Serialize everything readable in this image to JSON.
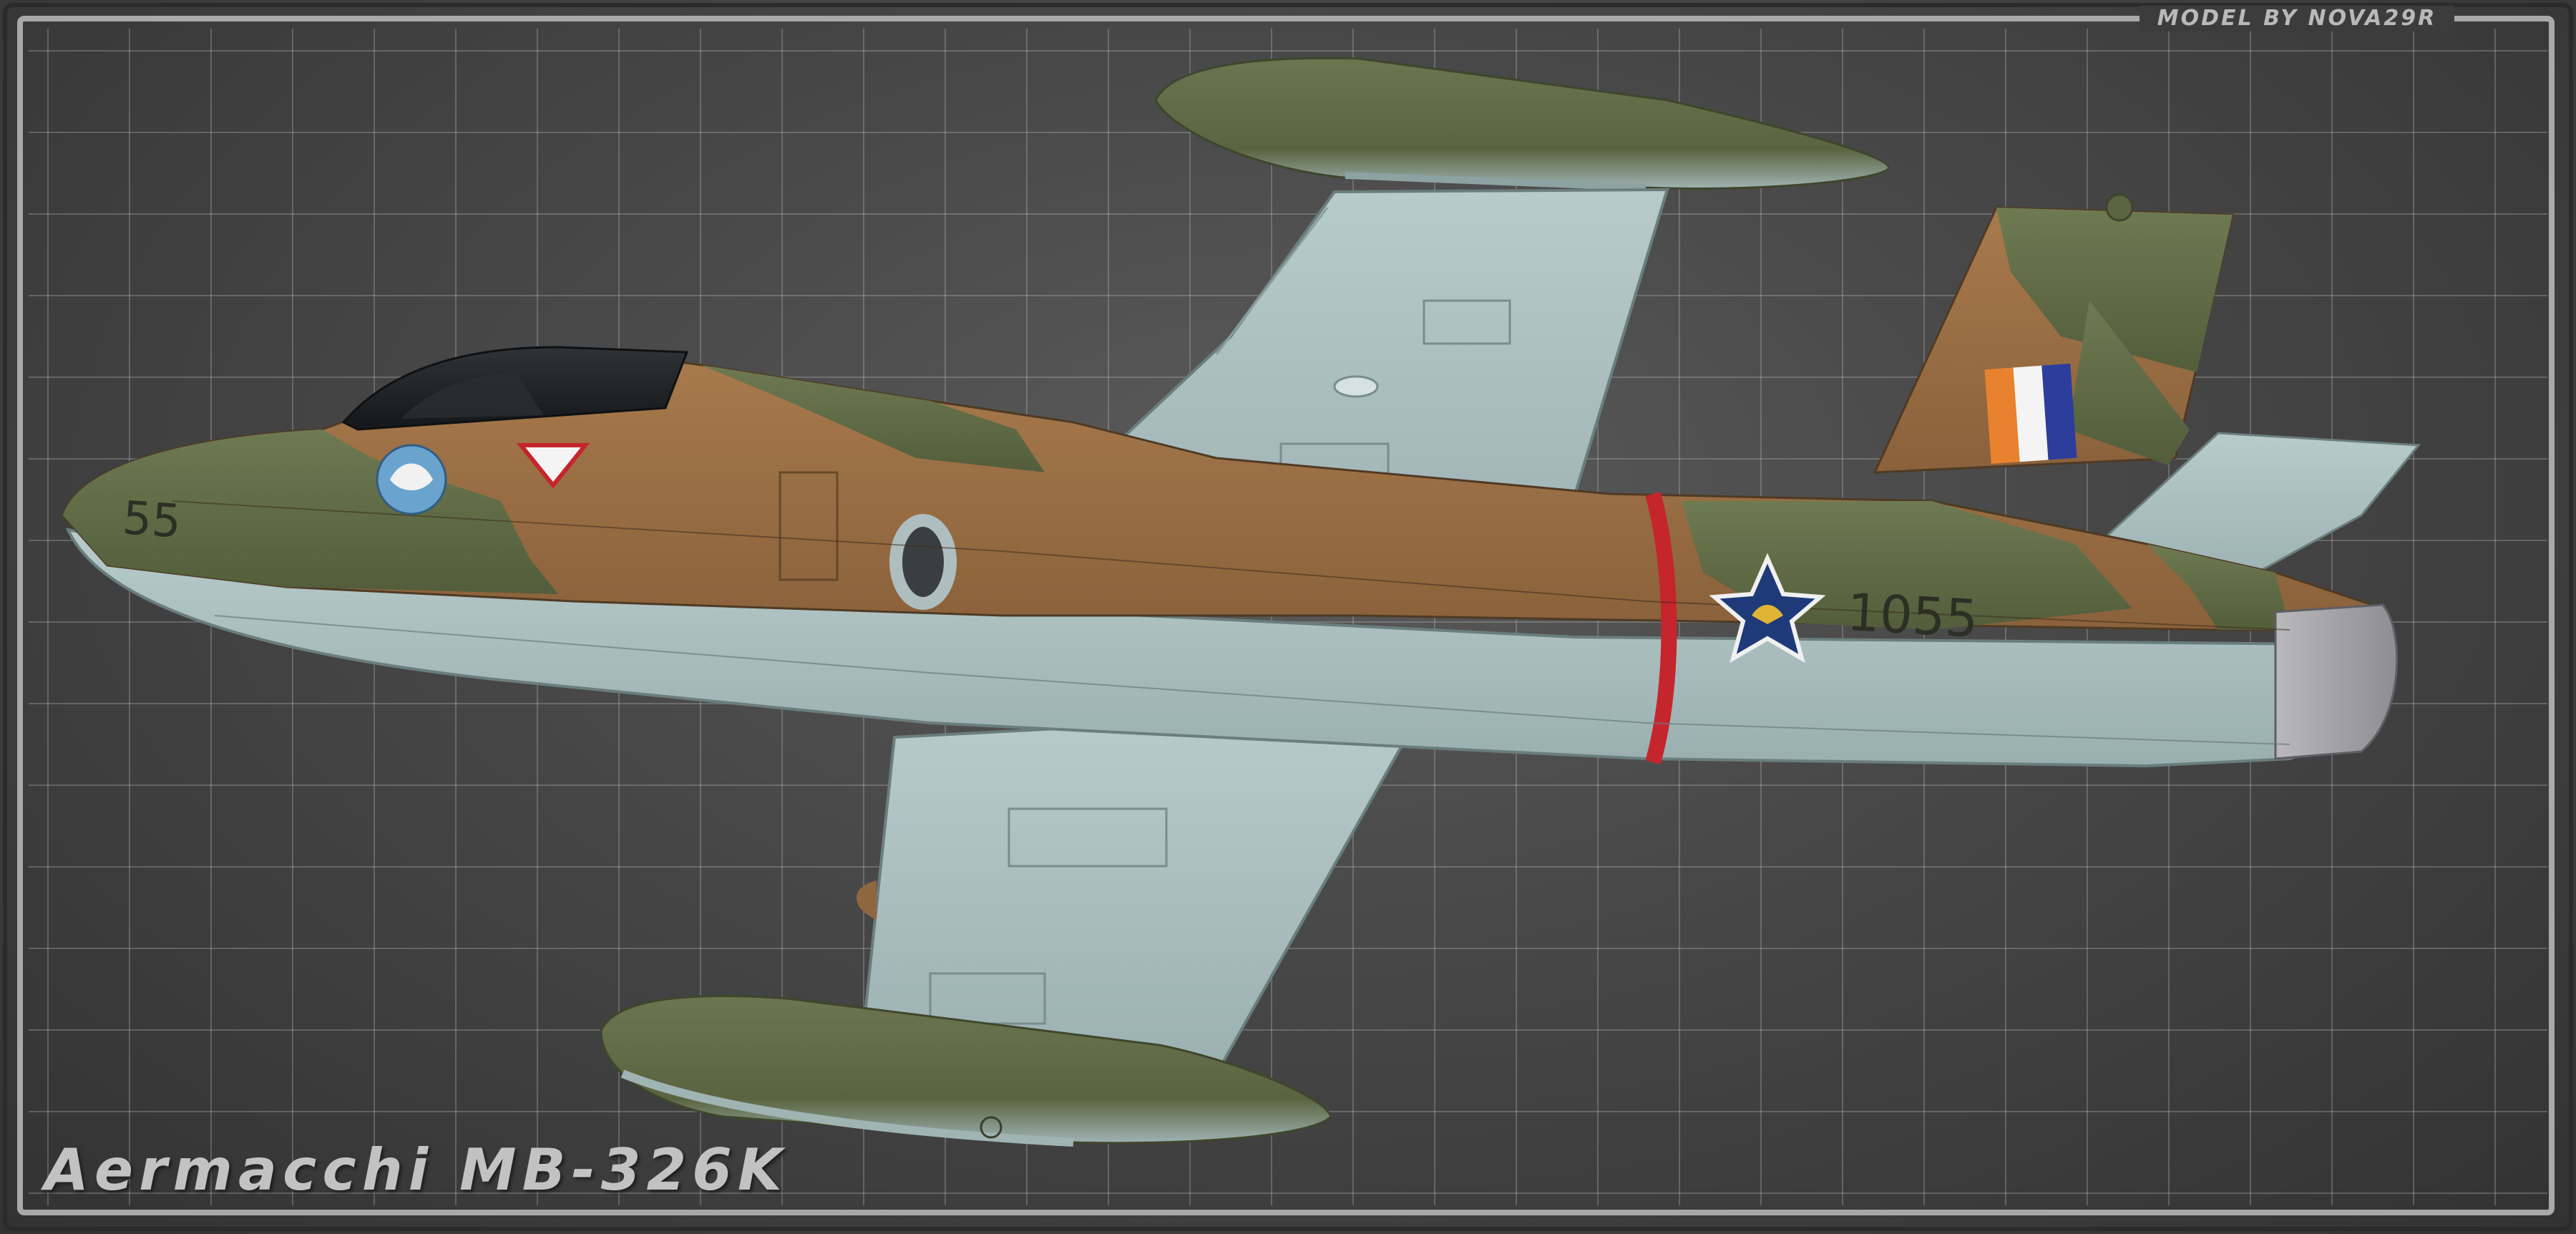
{
  "credit": "MODEL BY NOVA29R",
  "title": "Aermacchi MB-326K",
  "aircraft": {
    "nose_number": "55",
    "serial": "1055"
  },
  "colors": {
    "background": "#474747",
    "grid_line": "#8c8c8c",
    "frame": "#a9a9a9",
    "camo_olive": "#5f6a45",
    "camo_brown": "#9a6e45",
    "underside_blue": "#a9bcbc",
    "flag_orange": "#e8822e",
    "flag_white": "#f4f4f4",
    "flag_blue": "#2c3d9c",
    "roundel_blue": "#1f3a78",
    "stripe_red": "#c5252d"
  }
}
